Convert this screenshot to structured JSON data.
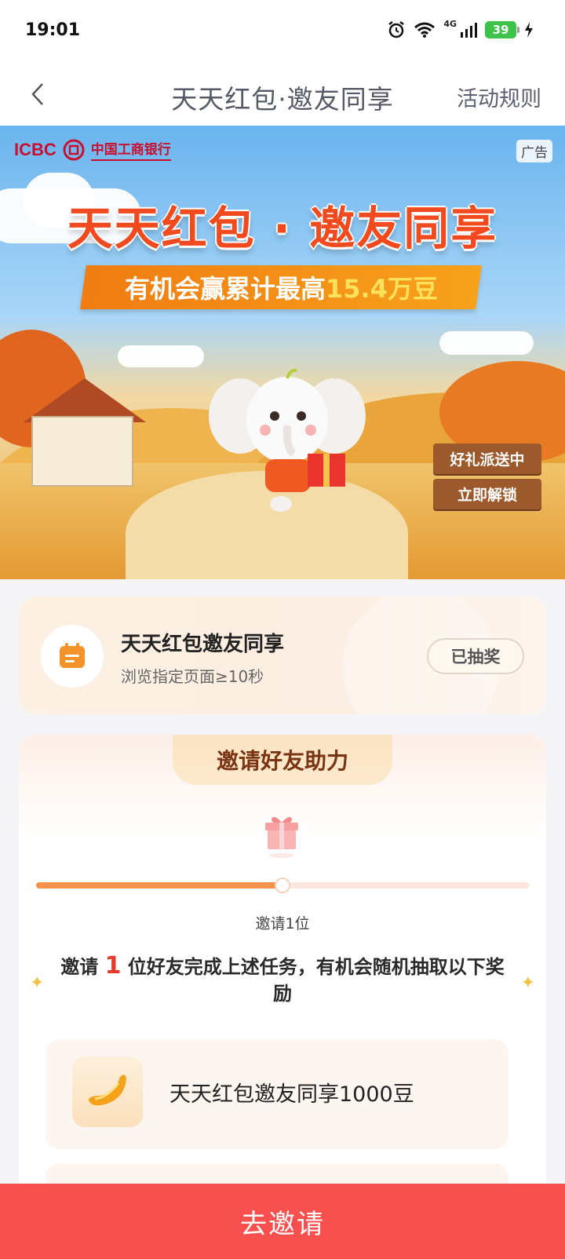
{
  "status_bar": {
    "time": "19:01",
    "network": "4G",
    "battery": "39"
  },
  "nav": {
    "title": "天天红包·邀友同享",
    "rules": "活动规则"
  },
  "banner": {
    "bank_en": "ICBC",
    "bank_cn": "中国工商银行",
    "ad_tag": "广告",
    "headline": "天天红包 · 邀友同享",
    "ribbon_prefix": "有机会赢累计最高",
    "ribbon_highlight": "15.4万豆",
    "sign_top": "好礼派送中",
    "sign_bottom": "立即解锁"
  },
  "task": {
    "title": "天天红包邀友同享",
    "subtitle": "浏览指定页面≥10秒",
    "button": "已抽奖"
  },
  "invite": {
    "tab_title": "邀请好友助力",
    "progress_fraction": 0.5,
    "progress_label": "邀请1位",
    "desc_prefix": "邀请",
    "desc_count": "1",
    "desc_suffix": "位好友完成上述任务，有机会随机抽取以下奖励",
    "reward_name": "天天红包邀友同享1000豆"
  },
  "bottom": {
    "invite_button": "去邀请"
  },
  "colors": {
    "primary_red": "#f7504f",
    "progress_orange": "#f4944a",
    "highlight_red": "#e53b2c"
  }
}
